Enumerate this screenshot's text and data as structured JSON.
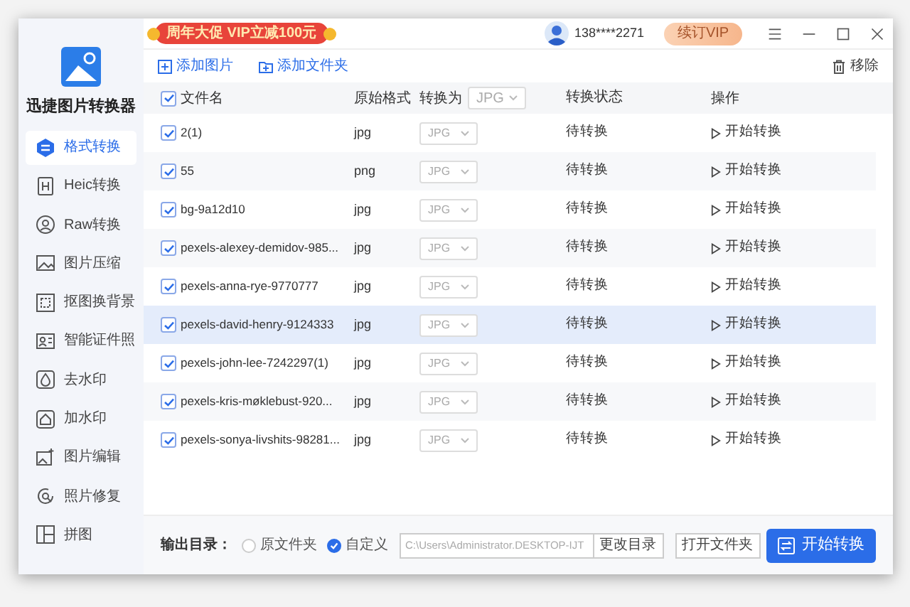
{
  "promo": {
    "text": "周年大促 VIP立减100元"
  },
  "user": {
    "phone": "138****2271"
  },
  "vip_button": "续订VIP",
  "app_name": "迅捷图片转换器",
  "sidebar": {
    "items": [
      {
        "label": "格式转换",
        "selected": true
      },
      {
        "label": "Heic转换",
        "selected": false
      },
      {
        "label": "Raw转换",
        "selected": false
      },
      {
        "label": "图片压缩",
        "selected": false
      },
      {
        "label": "抠图换背景",
        "selected": false
      },
      {
        "label": "智能证件照",
        "selected": false
      },
      {
        "label": "去水印",
        "selected": false
      },
      {
        "label": "加水印",
        "selected": false
      },
      {
        "label": "图片编辑",
        "selected": false
      },
      {
        "label": "照片修复",
        "selected": false
      },
      {
        "label": "拼图",
        "selected": false
      }
    ]
  },
  "toolbar": {
    "add_image": "添加图片",
    "add_folder": "添加文件夹",
    "remove": "移除"
  },
  "table": {
    "header_checked": true,
    "columns": [
      "文件名",
      "原始格式",
      "转换为",
      "转换状态",
      "操作"
    ],
    "header_format": "JPG",
    "rows": [
      {
        "checked": true,
        "name": "2(1)",
        "format": "jpg",
        "target": "JPG",
        "status": "待转换",
        "action": "开始转换",
        "selected": false
      },
      {
        "checked": true,
        "name": "55",
        "format": "png",
        "target": "JPG",
        "status": "待转换",
        "action": "开始转换",
        "selected": false
      },
      {
        "checked": true,
        "name": "bg-9a12d10",
        "format": "jpg",
        "target": "JPG",
        "status": "待转换",
        "action": "开始转换",
        "selected": false
      },
      {
        "checked": true,
        "name": "pexels-alexey-demidov-985...",
        "format": "jpg",
        "target": "JPG",
        "status": "待转换",
        "action": "开始转换",
        "selected": false
      },
      {
        "checked": true,
        "name": "pexels-anna-rye-9770777",
        "format": "jpg",
        "target": "JPG",
        "status": "待转换",
        "action": "开始转换",
        "selected": false
      },
      {
        "checked": true,
        "name": "pexels-david-henry-9124333",
        "format": "jpg",
        "target": "JPG",
        "status": "待转换",
        "action": "开始转换",
        "selected": true
      },
      {
        "checked": true,
        "name": "pexels-john-lee-7242297(1)",
        "format": "jpg",
        "target": "JPG",
        "status": "待转换",
        "action": "开始转换",
        "selected": false
      },
      {
        "checked": true,
        "name": "pexels-kris-møklebust-920...",
        "format": "jpg",
        "target": "JPG",
        "status": "待转换",
        "action": "开始转换",
        "selected": false
      },
      {
        "checked": true,
        "name": "pexels-sonya-livshits-98281...",
        "format": "jpg",
        "target": "JPG",
        "status": "待转换",
        "action": "开始转换",
        "selected": false
      }
    ]
  },
  "output": {
    "label": "输出目录：",
    "options": [
      {
        "label": "原文件夹",
        "selected": false
      },
      {
        "label": "自定义",
        "selected": true
      }
    ],
    "path": "C:\\Users\\Administrator.DESKTOP-IJT",
    "change_button": "更改目录",
    "open_button": "打开文件夹"
  },
  "start_button": "开始转换"
}
